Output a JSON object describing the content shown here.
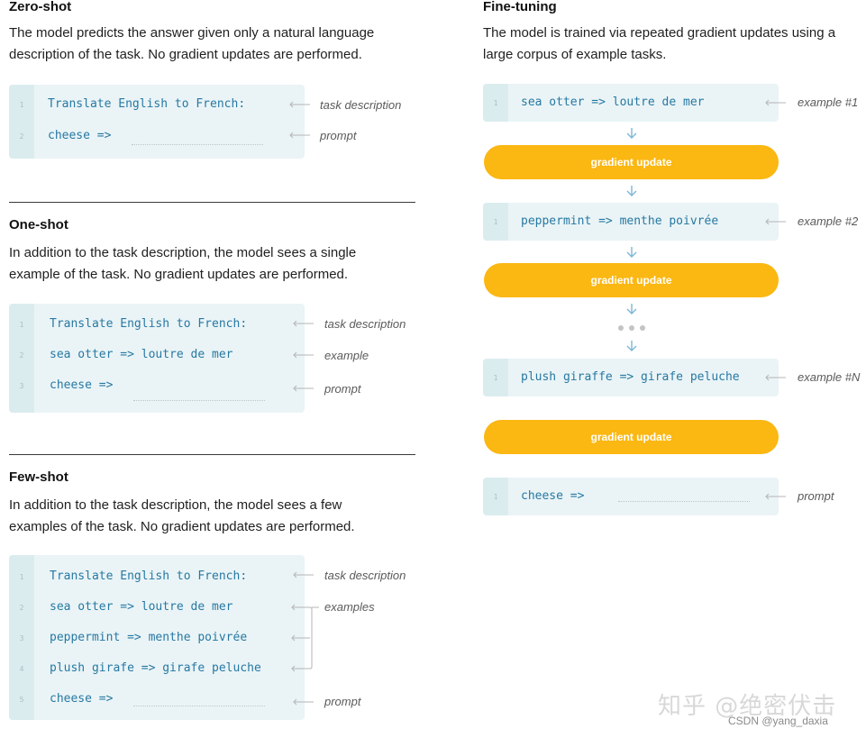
{
  "zero_shot": {
    "heading": "Zero-shot",
    "description_line1": "The model predicts the answer given only a natural language",
    "description_line2": "description of the task. No gradient updates are performed.",
    "lines": [
      {
        "num": "1",
        "code": "Translate English to French:"
      },
      {
        "num": "2",
        "code": "cheese =>"
      }
    ],
    "annotations": [
      "task description",
      "prompt"
    ]
  },
  "one_shot": {
    "heading": "One-shot",
    "description_line1": "In addition to the task description, the model sees a single",
    "description_line2": "example of the task. No gradient updates are performed.",
    "lines": [
      {
        "num": "1",
        "code": "Translate English to French:"
      },
      {
        "num": "2",
        "code": "sea otter => loutre de mer"
      },
      {
        "num": "3",
        "code": "cheese =>"
      }
    ],
    "annotations": [
      "task description",
      "example",
      "prompt"
    ]
  },
  "few_shot": {
    "heading": "Few-shot",
    "description_line1": "In addition to the task description, the model sees a few",
    "description_line2": "examples of the task. No gradient updates are performed.",
    "lines": [
      {
        "num": "1",
        "code": "Translate English to French:"
      },
      {
        "num": "2",
        "code": "sea otter => loutre de mer"
      },
      {
        "num": "3",
        "code": "peppermint => menthe poivrée"
      },
      {
        "num": "4",
        "code": "plush girafe => girafe peluche"
      },
      {
        "num": "5",
        "code": "cheese =>"
      }
    ],
    "annotations": [
      "task description",
      "examples",
      "prompt"
    ]
  },
  "fine_tuning": {
    "heading": "Fine-tuning",
    "description_line1": "The model is trained via repeated gradient updates using a",
    "description_line2": "large corpus of example tasks.",
    "examples": [
      {
        "num": "1",
        "code": "sea otter => loutre de mer",
        "annotation": "example #1"
      },
      {
        "num": "1",
        "code": "peppermint => menthe poivrée",
        "annotation": "example #2"
      },
      {
        "num": "1",
        "code": "plush giraffe => girafe peluche",
        "annotation": "example #N"
      }
    ],
    "gradient_label": "gradient update",
    "prompt": {
      "num": "1",
      "code": "cheese =>",
      "annotation": "prompt"
    }
  },
  "colors": {
    "code_text": "#2778a3",
    "code_bg": "#eaf4f6",
    "gutter_bg": "#dbecef",
    "gradient_pill": "#fbb712",
    "arrow_blue": "#7eb6d6"
  },
  "watermark": {
    "chinese": "知乎 @绝密伏击",
    "csdn": "CSDN @yang_daxia"
  }
}
